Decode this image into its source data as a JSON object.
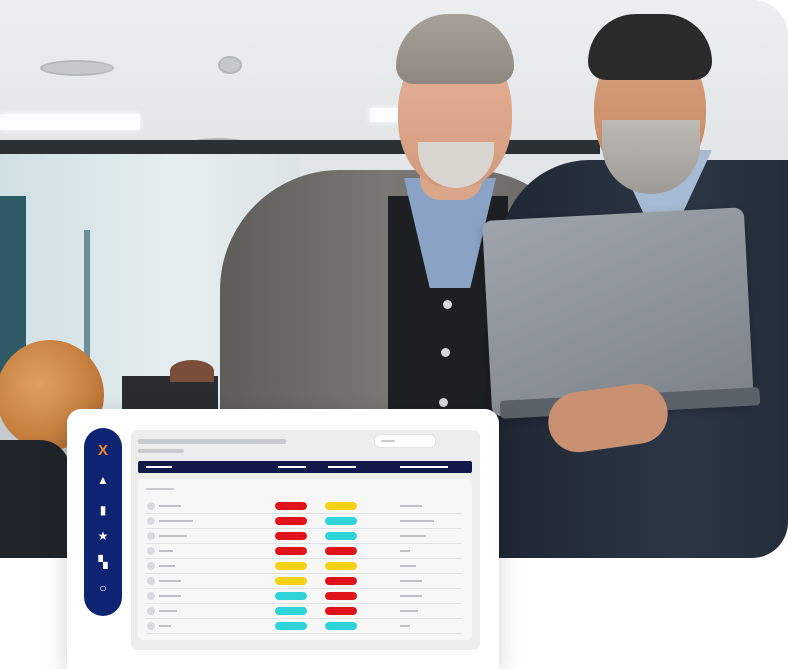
{
  "colors": {
    "sidebar": "#0f2373",
    "header_bar": "#111a4a",
    "logo_accent": "#f0882a",
    "status_red": "#e0131a",
    "status_yellow": "#f6d216",
    "status_cyan": "#2fd4d8"
  },
  "sidebar": {
    "items": [
      {
        "icon": "logo-x-icon",
        "glyph": "X"
      },
      {
        "icon": "alert-triangle-icon",
        "glyph": "▲"
      },
      {
        "icon": "bar-chart-icon",
        "glyph": "▮"
      },
      {
        "icon": "star-icon",
        "glyph": "★"
      },
      {
        "icon": "dashboard-grid-icon",
        "glyph": "▚"
      },
      {
        "icon": "circle-icon",
        "glyph": "○"
      }
    ]
  },
  "table": {
    "rows": [
      {
        "status_a": "red",
        "status_b": "yellow"
      },
      {
        "status_a": "red",
        "status_b": "cyan"
      },
      {
        "status_a": "red",
        "status_b": "cyan"
      },
      {
        "status_a": "red",
        "status_b": "red"
      },
      {
        "status_a": "yellow",
        "status_b": "yellow"
      },
      {
        "status_a": "yellow",
        "status_b": "red"
      },
      {
        "status_a": "cyan",
        "status_b": "red"
      },
      {
        "status_a": "cyan",
        "status_b": "red"
      },
      {
        "status_a": "cyan",
        "status_b": "cyan"
      }
    ]
  }
}
